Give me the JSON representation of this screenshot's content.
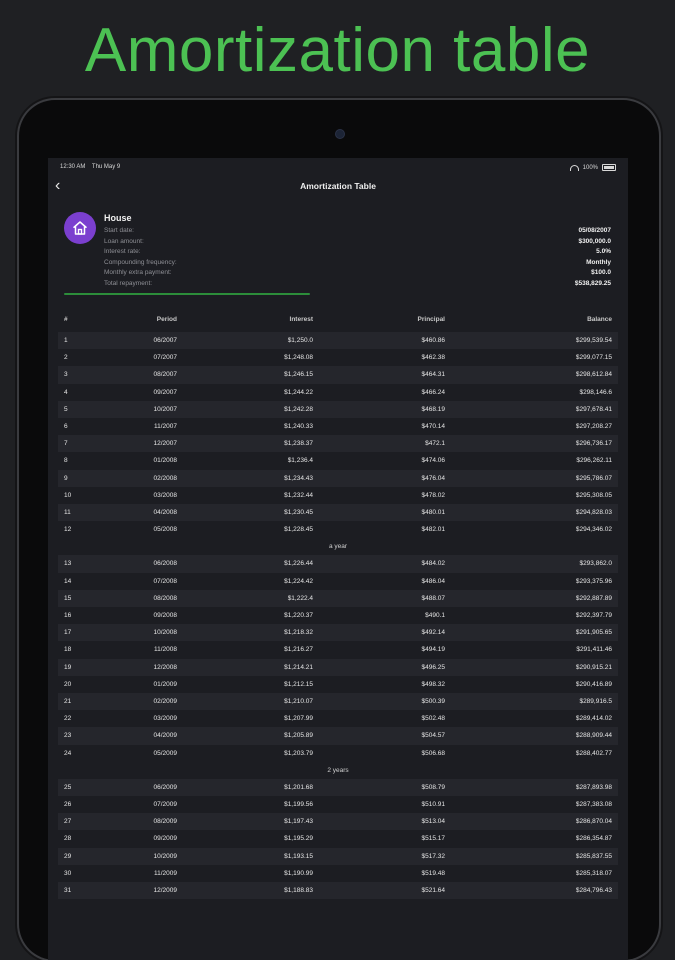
{
  "headline": "Amortization table",
  "status": {
    "time": "12:30 AM",
    "date": "Thu May 9",
    "battery": "100%"
  },
  "nav": {
    "title": "Amortization Table"
  },
  "loan": {
    "name": "House",
    "labels": [
      "Start date:",
      "Loan amount:",
      "Interest rate:",
      "Compounding frequency:",
      "Monthly extra payment:",
      "Total repayment:"
    ],
    "values": [
      "05/08/2007",
      "$300,000.0",
      "5.0%",
      "Monthly",
      "$100.0",
      "$538,829.25"
    ],
    "paid_fraction": 0.44
  },
  "table": {
    "headers": {
      "num": "#",
      "period": "Period",
      "interest": "Interest",
      "principal": "Principal",
      "balance": "Balance"
    },
    "groups": [
      {
        "label": "",
        "rows": [
          [
            "1",
            "06/2007",
            "$1,250.0",
            "$460.86",
            "$299,539.54"
          ],
          [
            "2",
            "07/2007",
            "$1,248.08",
            "$462.38",
            "$299,077.15"
          ],
          [
            "3",
            "08/2007",
            "$1,246.15",
            "$464.31",
            "$298,612.84"
          ],
          [
            "4",
            "09/2007",
            "$1,244.22",
            "$466.24",
            "$298,146.6"
          ],
          [
            "5",
            "10/2007",
            "$1,242.28",
            "$468.19",
            "$297,678.41"
          ],
          [
            "6",
            "11/2007",
            "$1,240.33",
            "$470.14",
            "$297,208.27"
          ],
          [
            "7",
            "12/2007",
            "$1,238.37",
            "$472.1",
            "$296,736.17"
          ],
          [
            "8",
            "01/2008",
            "$1,236.4",
            "$474.06",
            "$296,262.11"
          ],
          [
            "9",
            "02/2008",
            "$1,234.43",
            "$476.04",
            "$295,786.07"
          ],
          [
            "10",
            "03/2008",
            "$1,232.44",
            "$478.02",
            "$295,308.05"
          ],
          [
            "11",
            "04/2008",
            "$1,230.45",
            "$480.01",
            "$294,828.03"
          ],
          [
            "12",
            "05/2008",
            "$1,228.45",
            "$482.01",
            "$294,346.02"
          ]
        ]
      },
      {
        "label": "a year",
        "rows": [
          [
            "13",
            "06/2008",
            "$1,226.44",
            "$484.02",
            "$293,862.0"
          ],
          [
            "14",
            "07/2008",
            "$1,224.42",
            "$486.04",
            "$293,375.96"
          ],
          [
            "15",
            "08/2008",
            "$1,222.4",
            "$488.07",
            "$292,887.89"
          ],
          [
            "16",
            "09/2008",
            "$1,220.37",
            "$490.1",
            "$292,397.79"
          ],
          [
            "17",
            "10/2008",
            "$1,218.32",
            "$492.14",
            "$291,905.65"
          ],
          [
            "18",
            "11/2008",
            "$1,216.27",
            "$494.19",
            "$291,411.46"
          ],
          [
            "19",
            "12/2008",
            "$1,214.21",
            "$496.25",
            "$290,915.21"
          ],
          [
            "20",
            "01/2009",
            "$1,212.15",
            "$498.32",
            "$290,416.89"
          ],
          [
            "21",
            "02/2009",
            "$1,210.07",
            "$500.39",
            "$289,916.5"
          ],
          [
            "22",
            "03/2009",
            "$1,207.99",
            "$502.48",
            "$289,414.02"
          ],
          [
            "23",
            "04/2009",
            "$1,205.89",
            "$504.57",
            "$288,909.44"
          ],
          [
            "24",
            "05/2009",
            "$1,203.79",
            "$506.68",
            "$288,402.77"
          ]
        ]
      },
      {
        "label": "2 years",
        "rows": [
          [
            "25",
            "06/2009",
            "$1,201.68",
            "$508.79",
            "$287,893.98"
          ],
          [
            "26",
            "07/2009",
            "$1,199.56",
            "$510.91",
            "$287,383.08"
          ],
          [
            "27",
            "08/2009",
            "$1,197.43",
            "$513.04",
            "$286,870.04"
          ],
          [
            "28",
            "09/2009",
            "$1,195.29",
            "$515.17",
            "$286,354.87"
          ],
          [
            "29",
            "10/2009",
            "$1,193.15",
            "$517.32",
            "$285,837.55"
          ],
          [
            "30",
            "11/2009",
            "$1,190.99",
            "$519.48",
            "$285,318.07"
          ],
          [
            "31",
            "12/2009",
            "$1,188.83",
            "$521.64",
            "$284,796.43"
          ]
        ]
      }
    ]
  }
}
